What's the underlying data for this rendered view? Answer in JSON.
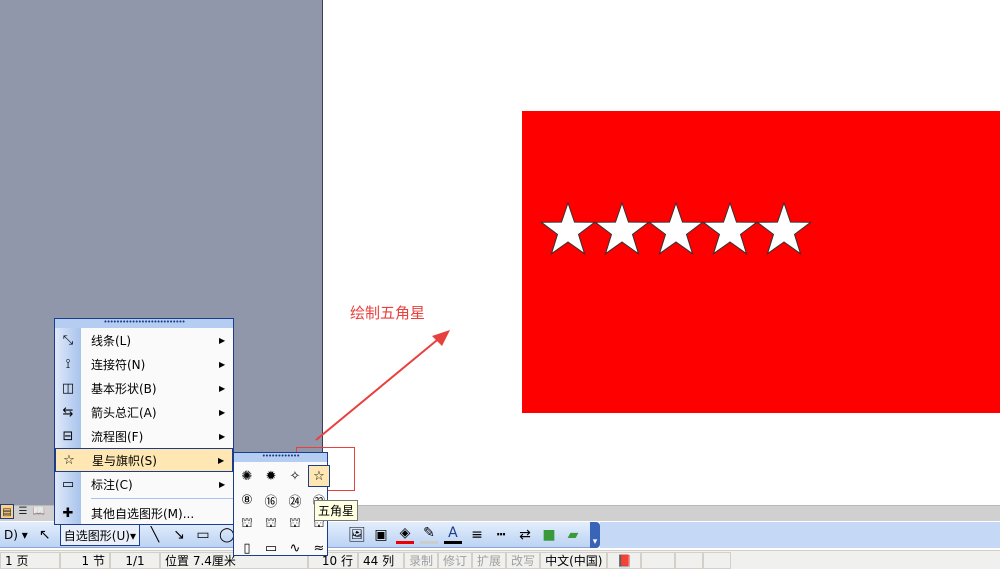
{
  "canvas": {
    "annotation": "绘制五角星",
    "flag_color": "#ff0000",
    "star_count": 5,
    "accent": "#e8413d"
  },
  "menu": {
    "items": [
      {
        "icon": "line-icon",
        "glyph": "⤡",
        "label": "线条(L)",
        "arrow": "▶"
      },
      {
        "icon": "connector-icon",
        "glyph": "⟟",
        "label": "连接符(N)",
        "arrow": "▶"
      },
      {
        "icon": "basic-shapes-icon",
        "glyph": "◫",
        "label": "基本形状(B)",
        "arrow": "▶"
      },
      {
        "icon": "block-arrows-icon",
        "glyph": "⇆",
        "label": "箭头总汇(A)",
        "arrow": "▶"
      },
      {
        "icon": "flowchart-icon",
        "glyph": "⊟",
        "label": "流程图(F)",
        "arrow": "▶"
      },
      {
        "icon": "stars-banners-icon",
        "glyph": "☆",
        "label": "星与旗帜(S)",
        "arrow": "▶"
      },
      {
        "icon": "callout-icon",
        "glyph": "▭",
        "label": "标注(C)",
        "arrow": "▶"
      },
      {
        "icon": "more-shapes-icon",
        "glyph": "✚",
        "label": "其他自选图形(M)..."
      }
    ]
  },
  "submenu": {
    "tooltip": "五角星",
    "shapes": [
      "✺",
      "✹",
      "✧",
      "☆",
      "⑧",
      "⑯",
      "㉔",
      "㉜",
      "⛫",
      "⛫",
      "⛫",
      "⛫",
      "▯",
      "▭",
      "∿",
      "≈"
    ]
  },
  "toolbar": {
    "draw_label": "D)",
    "autoshapes_label": "自选图形(U)",
    "dropdown": "▾"
  },
  "status": {
    "page": "1 页",
    "section": "1 节",
    "pages": "1/1",
    "position": "位置 7.4厘米",
    "line": "10 行",
    "column": "44 列",
    "rec": "录制",
    "trk": "修订",
    "ext": "扩展",
    "ovr": "改写",
    "language": "中文(中国)"
  }
}
